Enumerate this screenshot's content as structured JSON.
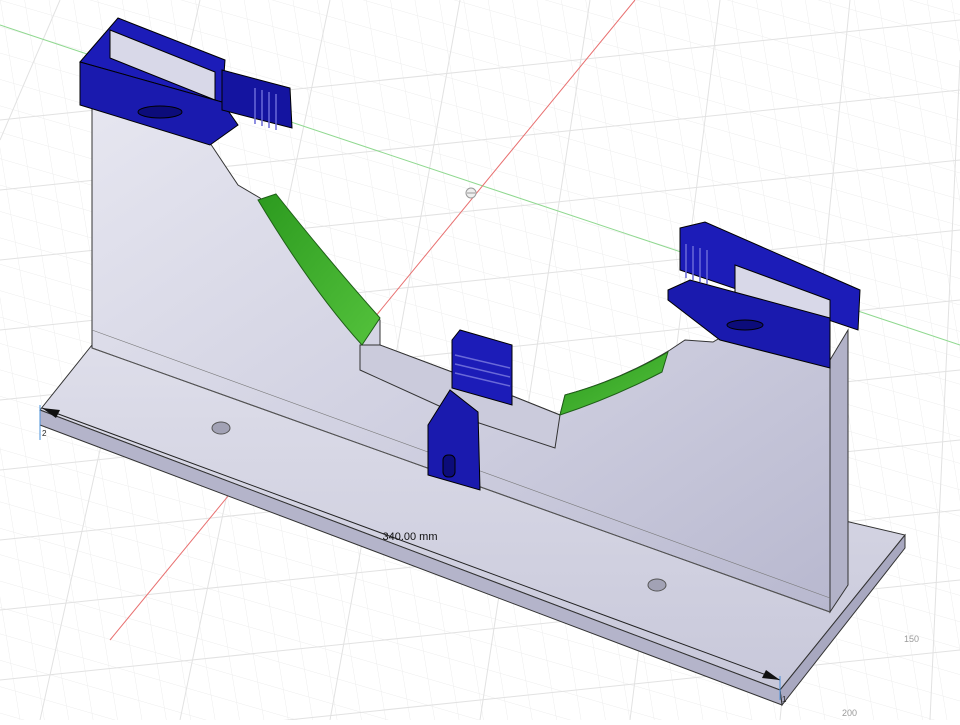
{
  "viewport": {
    "dimension_label": "340.00 mm",
    "endpoint_left_label": "2",
    "endpoint_right_label": "1",
    "grid_labels": [
      "150",
      "200"
    ]
  },
  "colors": {
    "background": "#ffffff",
    "grid_minor": "#eeeeee",
    "grid_major": "#d8d8d8",
    "axis_red": "#e06060",
    "axis_green": "#7ed37e",
    "body_face": "#dcdcea",
    "body_shadow": "#a9a9c0",
    "clip_blue": "#1a1ab4",
    "clip_blue_dark": "#0c0c7a",
    "highlight_green": "#34a624",
    "dimension_line": "#222222"
  },
  "icons": {
    "origin": "origin-point-icon",
    "arrow": "dimension-arrow-icon"
  }
}
